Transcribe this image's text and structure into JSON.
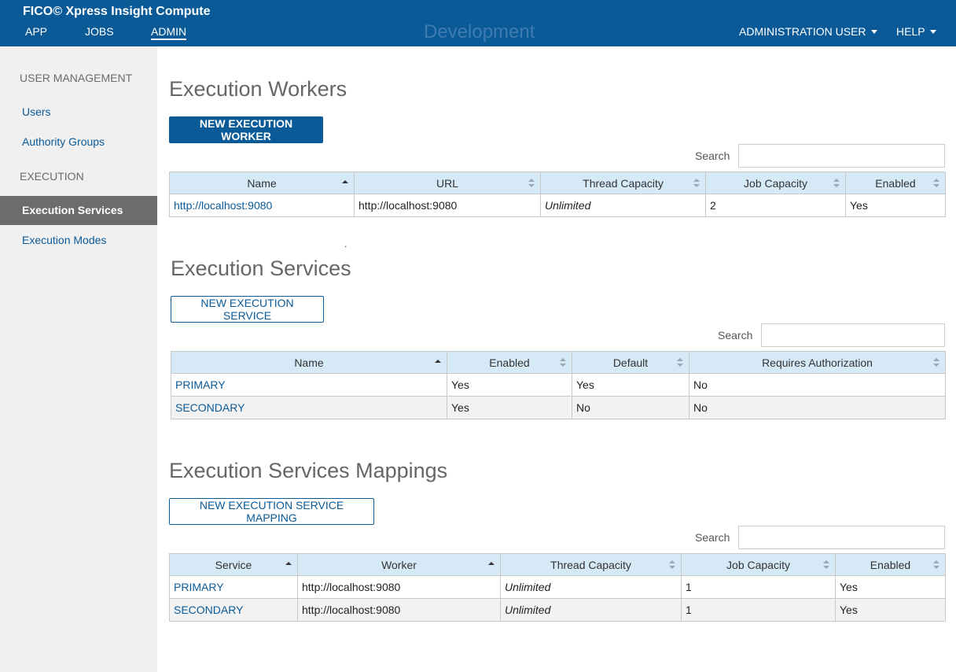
{
  "header": {
    "title": "FICO© Xpress Insight Compute",
    "nav": [
      "APP",
      "JOBS",
      "ADMIN"
    ],
    "environment": "Development",
    "user_menu": "ADMINISTRATION USER",
    "help_menu": "HELP"
  },
  "sidebar": {
    "user_management_label": "USER MANAGEMENT",
    "users": "Users",
    "authority_groups": "Authority Groups",
    "execution_label": "EXECUTION",
    "execution_services": "Execution Services",
    "execution_modes": "Execution Modes"
  },
  "workers": {
    "title": "Execution Workers",
    "new_button": "NEW EXECUTION WORKER",
    "search_label": "Search",
    "search_value": "",
    "columns": [
      "Name",
      "URL",
      "Thread Capacity",
      "Job Capacity",
      "Enabled"
    ],
    "rows": [
      [
        "http://localhost:9080",
        "http://localhost:9080",
        "Unlimited",
        "2",
        "Yes"
      ]
    ]
  },
  "separator": ".",
  "services": {
    "title": "Execution Services",
    "new_button": "NEW EXECUTION SERVICE",
    "search_label": "Search",
    "search_value": "",
    "columns": [
      "Name",
      "Enabled",
      "Default",
      "Requires Authorization"
    ],
    "rows": [
      [
        "PRIMARY",
        "Yes",
        "Yes",
        "No"
      ],
      [
        "SECONDARY",
        "Yes",
        "No",
        "No"
      ]
    ]
  },
  "mappings": {
    "title": "Execution Services Mappings",
    "new_button": "NEW EXECUTION SERVICE MAPPING",
    "search_label": "Search",
    "search_value": "",
    "columns": [
      "Service",
      "Worker",
      "Thread Capacity",
      "Job Capacity",
      "Enabled"
    ],
    "rows": [
      [
        "PRIMARY",
        "http://localhost:9080",
        "Unlimited",
        "1",
        "Yes"
      ],
      [
        "SECONDARY",
        "http://localhost:9080",
        "Unlimited",
        "1",
        "Yes"
      ]
    ]
  },
  "colors": {
    "brand": "#0a5a98",
    "header_row": "#d6e9f6",
    "sidebar_bg": "#f0f0f0",
    "sidebar_active": "#6b6c6b"
  }
}
